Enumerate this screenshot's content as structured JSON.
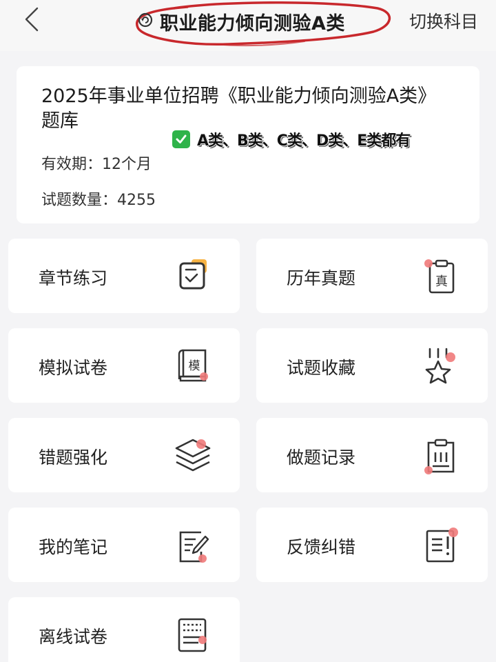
{
  "header": {
    "back_icon": "chevron-left-icon",
    "title": "职业能力倾向测验A类",
    "title_icon": "refresh-icon",
    "switch_label": "切换科目",
    "annotation_color": "#c8282c"
  },
  "info": {
    "title": "2025年事业单位招聘《职业能力倾向测验A类》题库",
    "annotation": "A类、B类、C类、D类、E类都有",
    "validity": "有效期：12个月",
    "count": "试题数量：4255"
  },
  "tiles": [
    {
      "label": "章节练习",
      "icon": "chapter-check-icon"
    },
    {
      "label": "历年真题",
      "icon": "past-exam-clipboard-icon"
    },
    {
      "label": "模拟试卷",
      "icon": "mock-exam-scroll-icon"
    },
    {
      "label": "试题收藏",
      "icon": "star-favorite-icon"
    },
    {
      "label": "错题强化",
      "icon": "layers-icon"
    },
    {
      "label": "做题记录",
      "icon": "record-clipboard-icon"
    },
    {
      "label": "我的笔记",
      "icon": "note-edit-icon"
    },
    {
      "label": "反馈纠错",
      "icon": "feedback-document-icon"
    },
    {
      "label": "离线试卷",
      "icon": "offline-document-icon"
    }
  ],
  "colors": {
    "accent_dot": "#f07a7a",
    "accent_orange": "#f5a623",
    "icon_stroke": "#333333",
    "background": "#f4f4f6"
  }
}
